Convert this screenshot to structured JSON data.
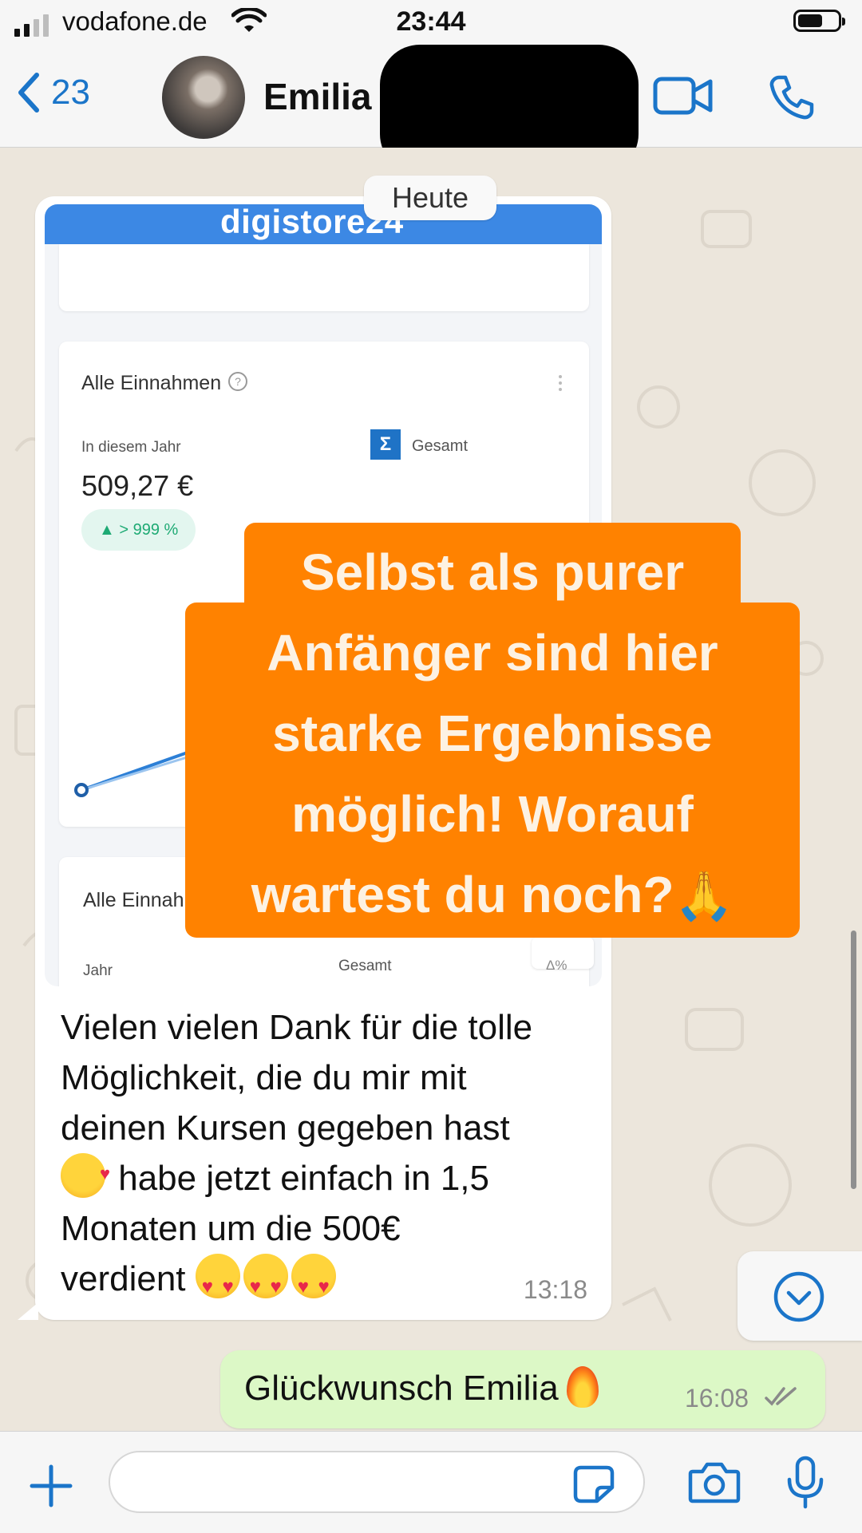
{
  "status_bar": {
    "carrier": "vodafone.de",
    "time": "23:44"
  },
  "nav": {
    "back_count": "23",
    "contact_name": "Emilia I"
  },
  "chat": {
    "date_label": "Heute",
    "incoming": {
      "screenshot": {
        "brand": "digistore24",
        "card_title": "Alle Einnahmen",
        "period_label": "In diesem Jahr",
        "total_label": "Gesamt",
        "amount": "509,27 €",
        "change": "▲ > 999 %",
        "card2_title": "Alle Einnah",
        "card2_period": "Jahr",
        "card2_total": "Gesamt",
        "card2_delta": "Δ%"
      },
      "text_lines": [
        "Vielen vielen Dank für die tolle",
        "Möglichkeit, die du mir mit",
        "deinen Kursen gegeben hast",
        " habe jetzt einfach in 1,5",
        "Monaten um die 500€",
        "verdient "
      ],
      "time": "13:18"
    },
    "outgoing": {
      "text": "Glückwunsch Emilia",
      "time": "16:08"
    }
  },
  "overlay": {
    "lines": [
      "Selbst als purer",
      "Anfänger sind hier",
      "starke Ergebnisse",
      "möglich! Worauf",
      "wartest du noch?"
    ],
    "emoji": "🙏",
    "color": "#ff8200"
  },
  "colors": {
    "accent": "#1b75c9",
    "outgoing_bubble": "#dcf8c6",
    "chat_bg": "#ece6dc"
  }
}
